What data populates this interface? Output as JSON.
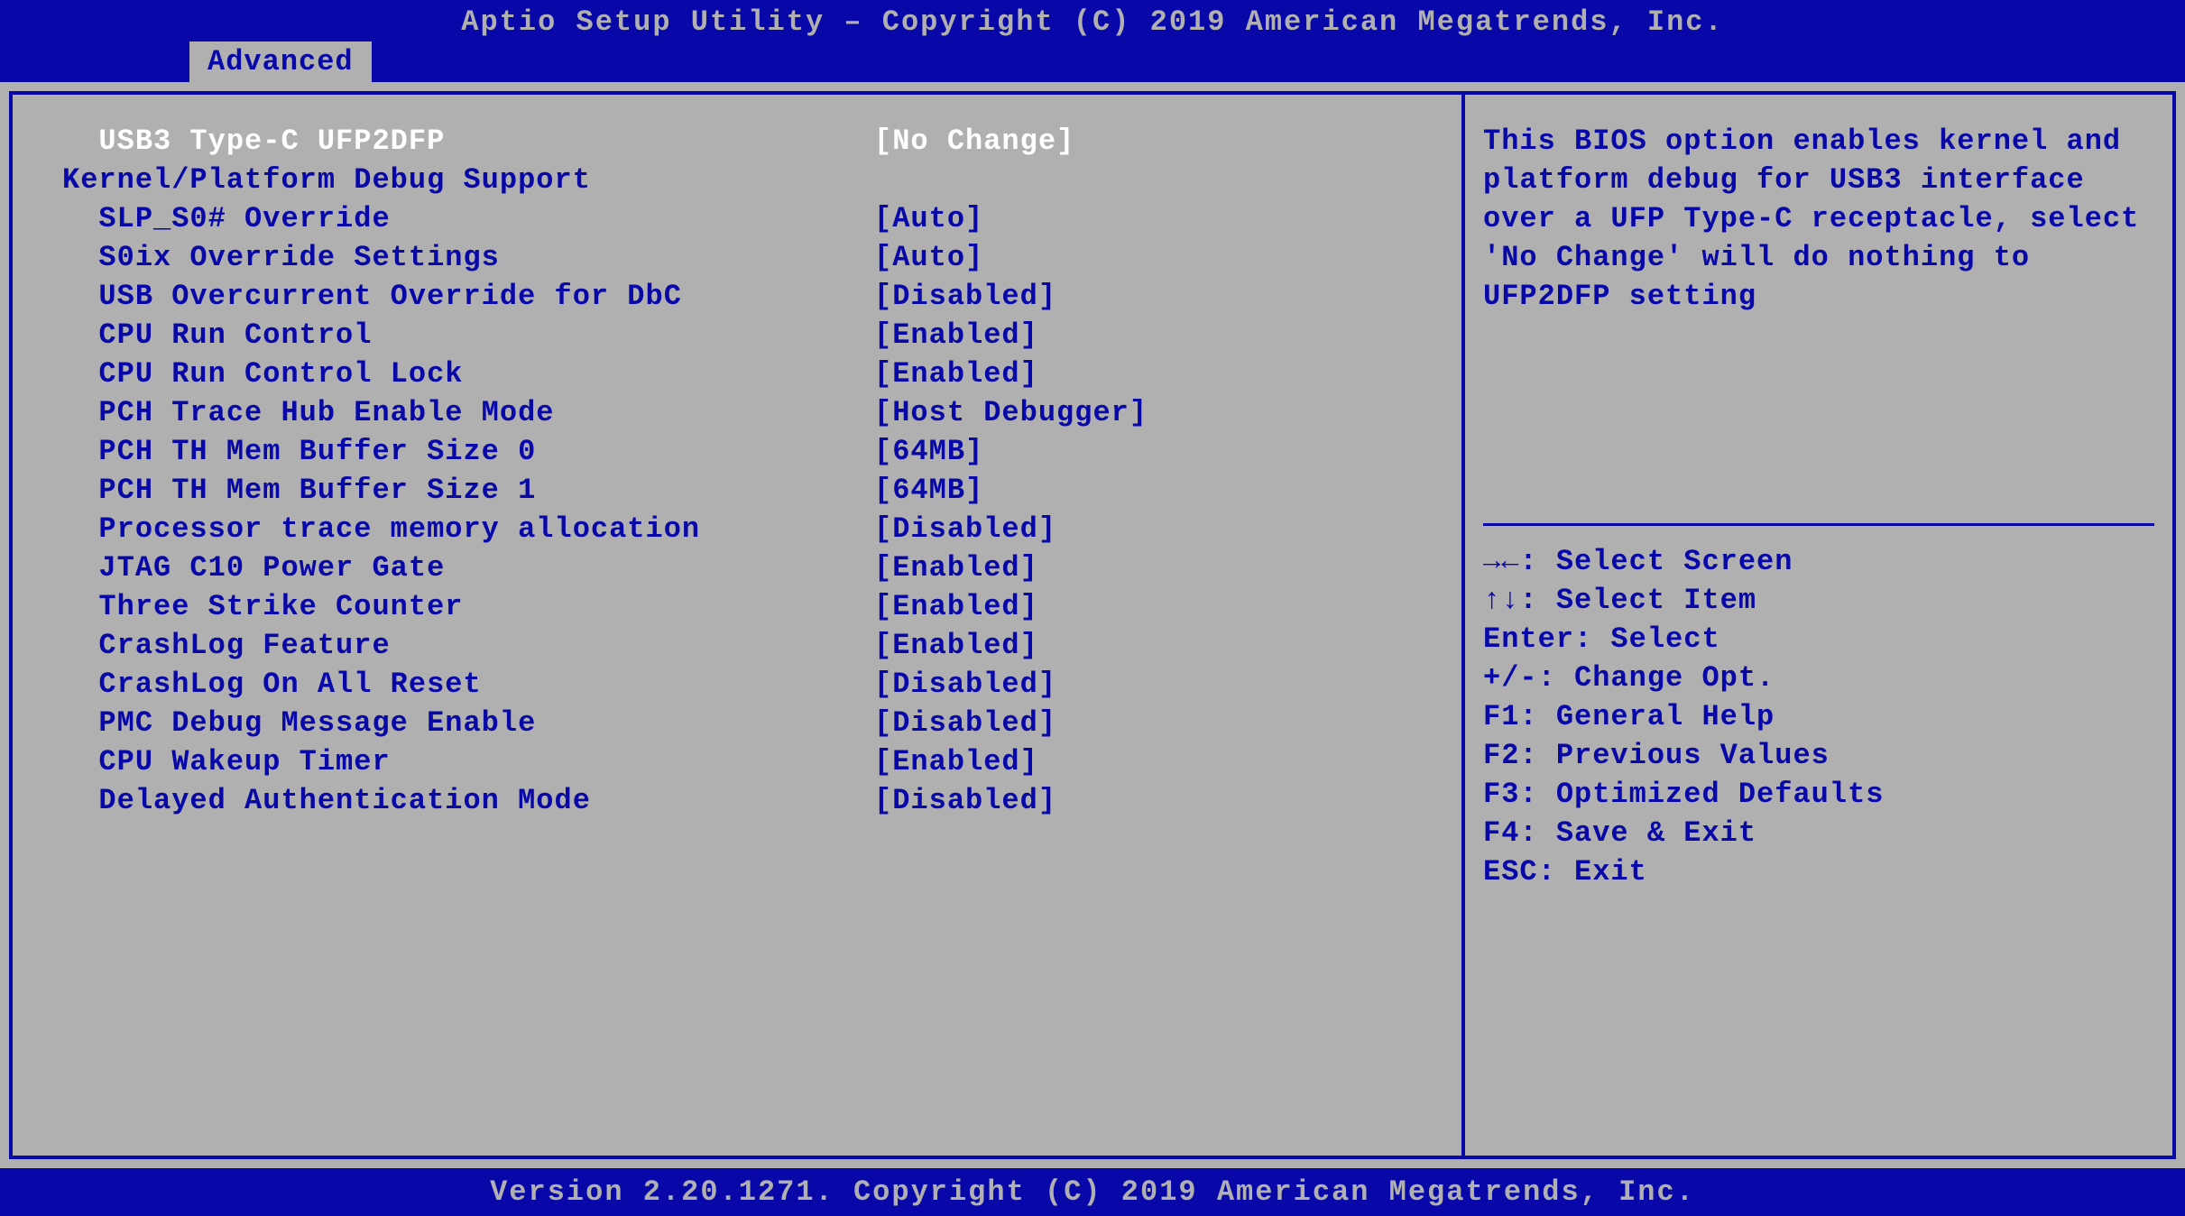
{
  "header": {
    "title": "Aptio Setup Utility – Copyright (C) 2019 American Megatrends, Inc."
  },
  "tab": {
    "label": "Advanced"
  },
  "settings": [
    {
      "label": "  USB3 Type-C UFP2DFP",
      "value": "[No Change]",
      "selected": true
    },
    {
      "label": "Kernel/Platform Debug Support",
      "value": "",
      "header": true
    },
    {
      "label": "  SLP_S0# Override",
      "value": "[Auto]"
    },
    {
      "label": "  S0ix Override Settings",
      "value": "[Auto]"
    },
    {
      "label": "  USB Overcurrent Override for DbC",
      "value": "[Disabled]"
    },
    {
      "label": "  CPU Run Control",
      "value": "[Enabled]"
    },
    {
      "label": "  CPU Run Control Lock",
      "value": "[Enabled]"
    },
    {
      "label": "  PCH Trace Hub Enable Mode",
      "value": "[Host Debugger]"
    },
    {
      "label": "  PCH TH Mem Buffer Size 0",
      "value": "[64MB]"
    },
    {
      "label": "  PCH TH Mem Buffer Size 1",
      "value": "[64MB]"
    },
    {
      "label": "  Processor trace memory allocation",
      "value": "[Disabled]"
    },
    {
      "label": "  JTAG C10 Power Gate",
      "value": "[Enabled]"
    },
    {
      "label": "  Three Strike Counter",
      "value": "[Enabled]"
    },
    {
      "label": "  CrashLog Feature",
      "value": "[Enabled]"
    },
    {
      "label": "  CrashLog On All Reset",
      "value": "[Disabled]"
    },
    {
      "label": "  PMC Debug Message Enable",
      "value": "[Disabled]"
    },
    {
      "label": "  CPU Wakeup Timer",
      "value": "[Enabled]"
    },
    {
      "label": "  Delayed Authentication Mode",
      "value": "[Disabled]"
    }
  ],
  "help": {
    "text": "This BIOS option enables kernel and platform debug for USB3 interface over a UFP Type-C receptacle, select 'No Change' will do nothing to UFP2DFP setting"
  },
  "nav": [
    {
      "key": "→←:",
      "action": "Select Screen",
      "arrows": "lr"
    },
    {
      "key": "↑↓:",
      "action": "Select Item",
      "arrows": "ud"
    },
    {
      "key": "Enter:",
      "action": "Select"
    },
    {
      "key": "+/-:",
      "action": "Change Opt."
    },
    {
      "key": "F1:",
      "action": "General Help"
    },
    {
      "key": "F2:",
      "action": "Previous Values"
    },
    {
      "key": "F3:",
      "action": "Optimized Defaults"
    },
    {
      "key": "F4:",
      "action": "Save & Exit"
    },
    {
      "key": "ESC:",
      "action": "Exit"
    }
  ],
  "footer": {
    "text": "Version 2.20.1271. Copyright (C) 2019 American Megatrends, Inc."
  }
}
